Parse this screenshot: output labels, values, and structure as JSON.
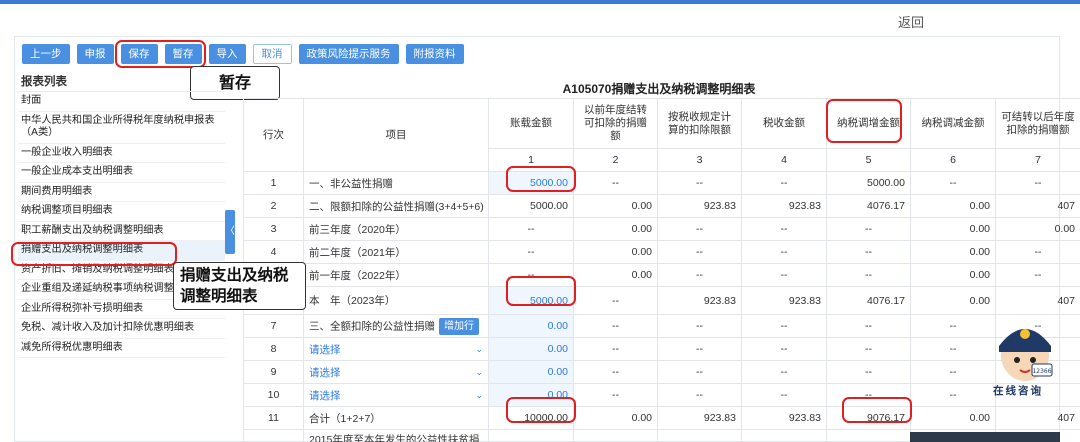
{
  "header": {
    "back_label": "返回"
  },
  "toolbar": {
    "buttons": [
      "上一步",
      "申报",
      "保存",
      "暂存",
      "导入",
      "取消",
      "政策风险提示服务",
      "附报资料"
    ]
  },
  "callouts": {
    "save_tip": "暂存",
    "donation_tip": "捐赠支出及纳税调整明细表"
  },
  "sidebar": {
    "title": "报表列表",
    "items": [
      "封面",
      "中华人民共和国企业所得税年度纳税申报表（A类）",
      "一般企业收入明细表",
      "一般企业成本支出明细表",
      "期间费用明细表",
      "纳税调整项目明细表",
      "职工薪酬支出及纳税调整明细表",
      "捐赠支出及纳税调整明细表",
      "资产折旧、摊销及纳税调整明细表",
      "企业重组及递延纳税事项纳税调整明细表",
      "企业所得税弥补亏损明细表",
      "免税、减计收入及加计扣除优惠明细表",
      "减免所得税优惠明细表"
    ],
    "collapse_glyph": "〈"
  },
  "table": {
    "title": "A105070捐赠支出及纳税调整明细表",
    "headers": [
      "行次",
      "项目",
      "账载金额",
      "以前年度结转可扣除的捐赠额",
      "按税收规定计算的扣除限额",
      "税收金额",
      "纳税调增金额",
      "纳税调减金额",
      "可结转以后年度扣除的捐赠额"
    ],
    "col_numbers": [
      "1",
      "2",
      "3",
      "4",
      "5",
      "6",
      "7"
    ],
    "add_row_label": "增加行",
    "select_placeholder": "请选择",
    "rows": [
      {
        "no": "1",
        "item": "一、非公益性捐赠",
        "v": [
          "5000.00",
          "--",
          "--",
          "--",
          "5000.00",
          "--",
          "--"
        ]
      },
      {
        "no": "2",
        "item": "二、限额扣除的公益性捐赠(3+4+5+6)",
        "v": [
          "5000.00",
          "0.00",
          "923.83",
          "923.83",
          "4076.17",
          "0.00",
          "407"
        ]
      },
      {
        "no": "3",
        "item": "前三年度（2020年）",
        "v": [
          "--",
          "0.00",
          "--",
          "--",
          "--",
          "0.00",
          "0.00"
        ]
      },
      {
        "no": "4",
        "item": "前二年度（2021年）",
        "v": [
          "--",
          "0.00",
          "--",
          "--",
          "--",
          "0.00",
          "--"
        ]
      },
      {
        "no": "5",
        "item": "前一年度（2022年）",
        "v": [
          "--",
          "0.00",
          "--",
          "--",
          "--",
          "0.00",
          "--"
        ]
      },
      {
        "no": "6",
        "item": "本　年（2023年）",
        "v": [
          "5000.00",
          "--",
          "923.83",
          "923.83",
          "4076.17",
          "0.00",
          "407"
        ]
      },
      {
        "no": "7",
        "item": "三、全额扣除的公益性捐赠",
        "v": [
          "0.00",
          "--",
          "--",
          "--",
          "--",
          "--",
          "--"
        ]
      },
      {
        "no": "8",
        "item": "",
        "v": [
          "0.00",
          "--",
          "--",
          "--",
          "--",
          "--",
          "--"
        ]
      },
      {
        "no": "9",
        "item": "",
        "v": [
          "0.00",
          "--",
          "--",
          "--",
          "--",
          "--",
          "--"
        ]
      },
      {
        "no": "10",
        "item": "",
        "v": [
          "0.00",
          "--",
          "--",
          "--",
          "--",
          "--",
          "--"
        ]
      },
      {
        "no": "11",
        "item": "合计（1+2+7）",
        "v": [
          "10000.00",
          "0.00",
          "923.83",
          "923.83",
          "9076.17",
          "0.00",
          "407"
        ]
      },
      {
        "no": "",
        "item": "2015年度至本年发生的公益性扶贫捐赠",
        "v": [
          "",
          "",
          "",
          "",
          "",
          "",
          ""
        ]
      }
    ]
  },
  "mascot": {
    "label": "在线咨询",
    "hotline": "12366"
  },
  "colors": {
    "accent": "#4a90e2",
    "highlight": "#e02020",
    "link": "#2c7be5"
  }
}
